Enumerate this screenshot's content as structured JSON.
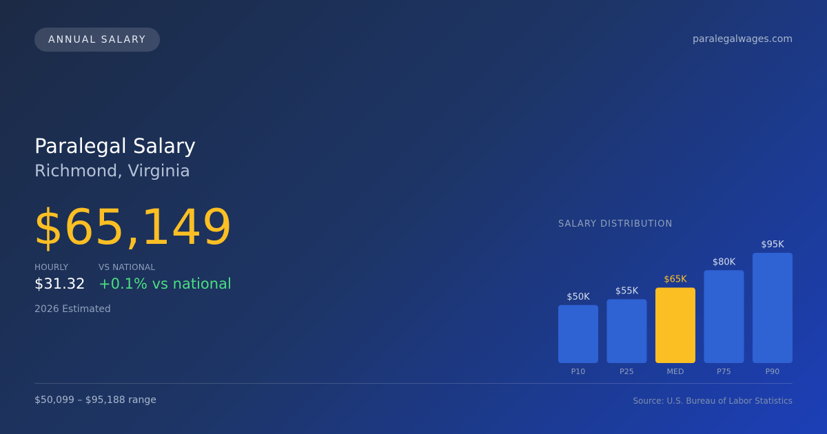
{
  "badge": "ANNUAL SALARY",
  "site": "paralegalwages.com",
  "title": "Paralegal Salary",
  "location": "Richmond, Virginia",
  "salary": "$65,149",
  "hourly": {
    "label": "HOURLY",
    "value": "$31.32"
  },
  "national": {
    "label": "VS NATIONAL",
    "value": "+0.1% vs national"
  },
  "estimate_note": "2026 Estimated",
  "range_text": "$50,099 – $95,188 range",
  "source": "Source: U.S. Bureau of Labor Statistics",
  "colors": {
    "accent": "#fbbf24",
    "positive": "#4ade80",
    "bar": "#2f62d3",
    "highlight": "#fbbf24"
  },
  "chart_data": {
    "type": "bar",
    "title": "SALARY DISTRIBUTION",
    "categories": [
      "P10",
      "P25",
      "MED",
      "P75",
      "P90"
    ],
    "values": [
      50,
      55,
      65,
      80,
      95
    ],
    "value_labels": [
      "$50K",
      "$55K",
      "$65K",
      "$80K",
      "$95K"
    ],
    "unit": "$K",
    "highlight_category": "MED",
    "ylim": [
      0,
      95
    ],
    "grid": false,
    "legend": "none"
  }
}
